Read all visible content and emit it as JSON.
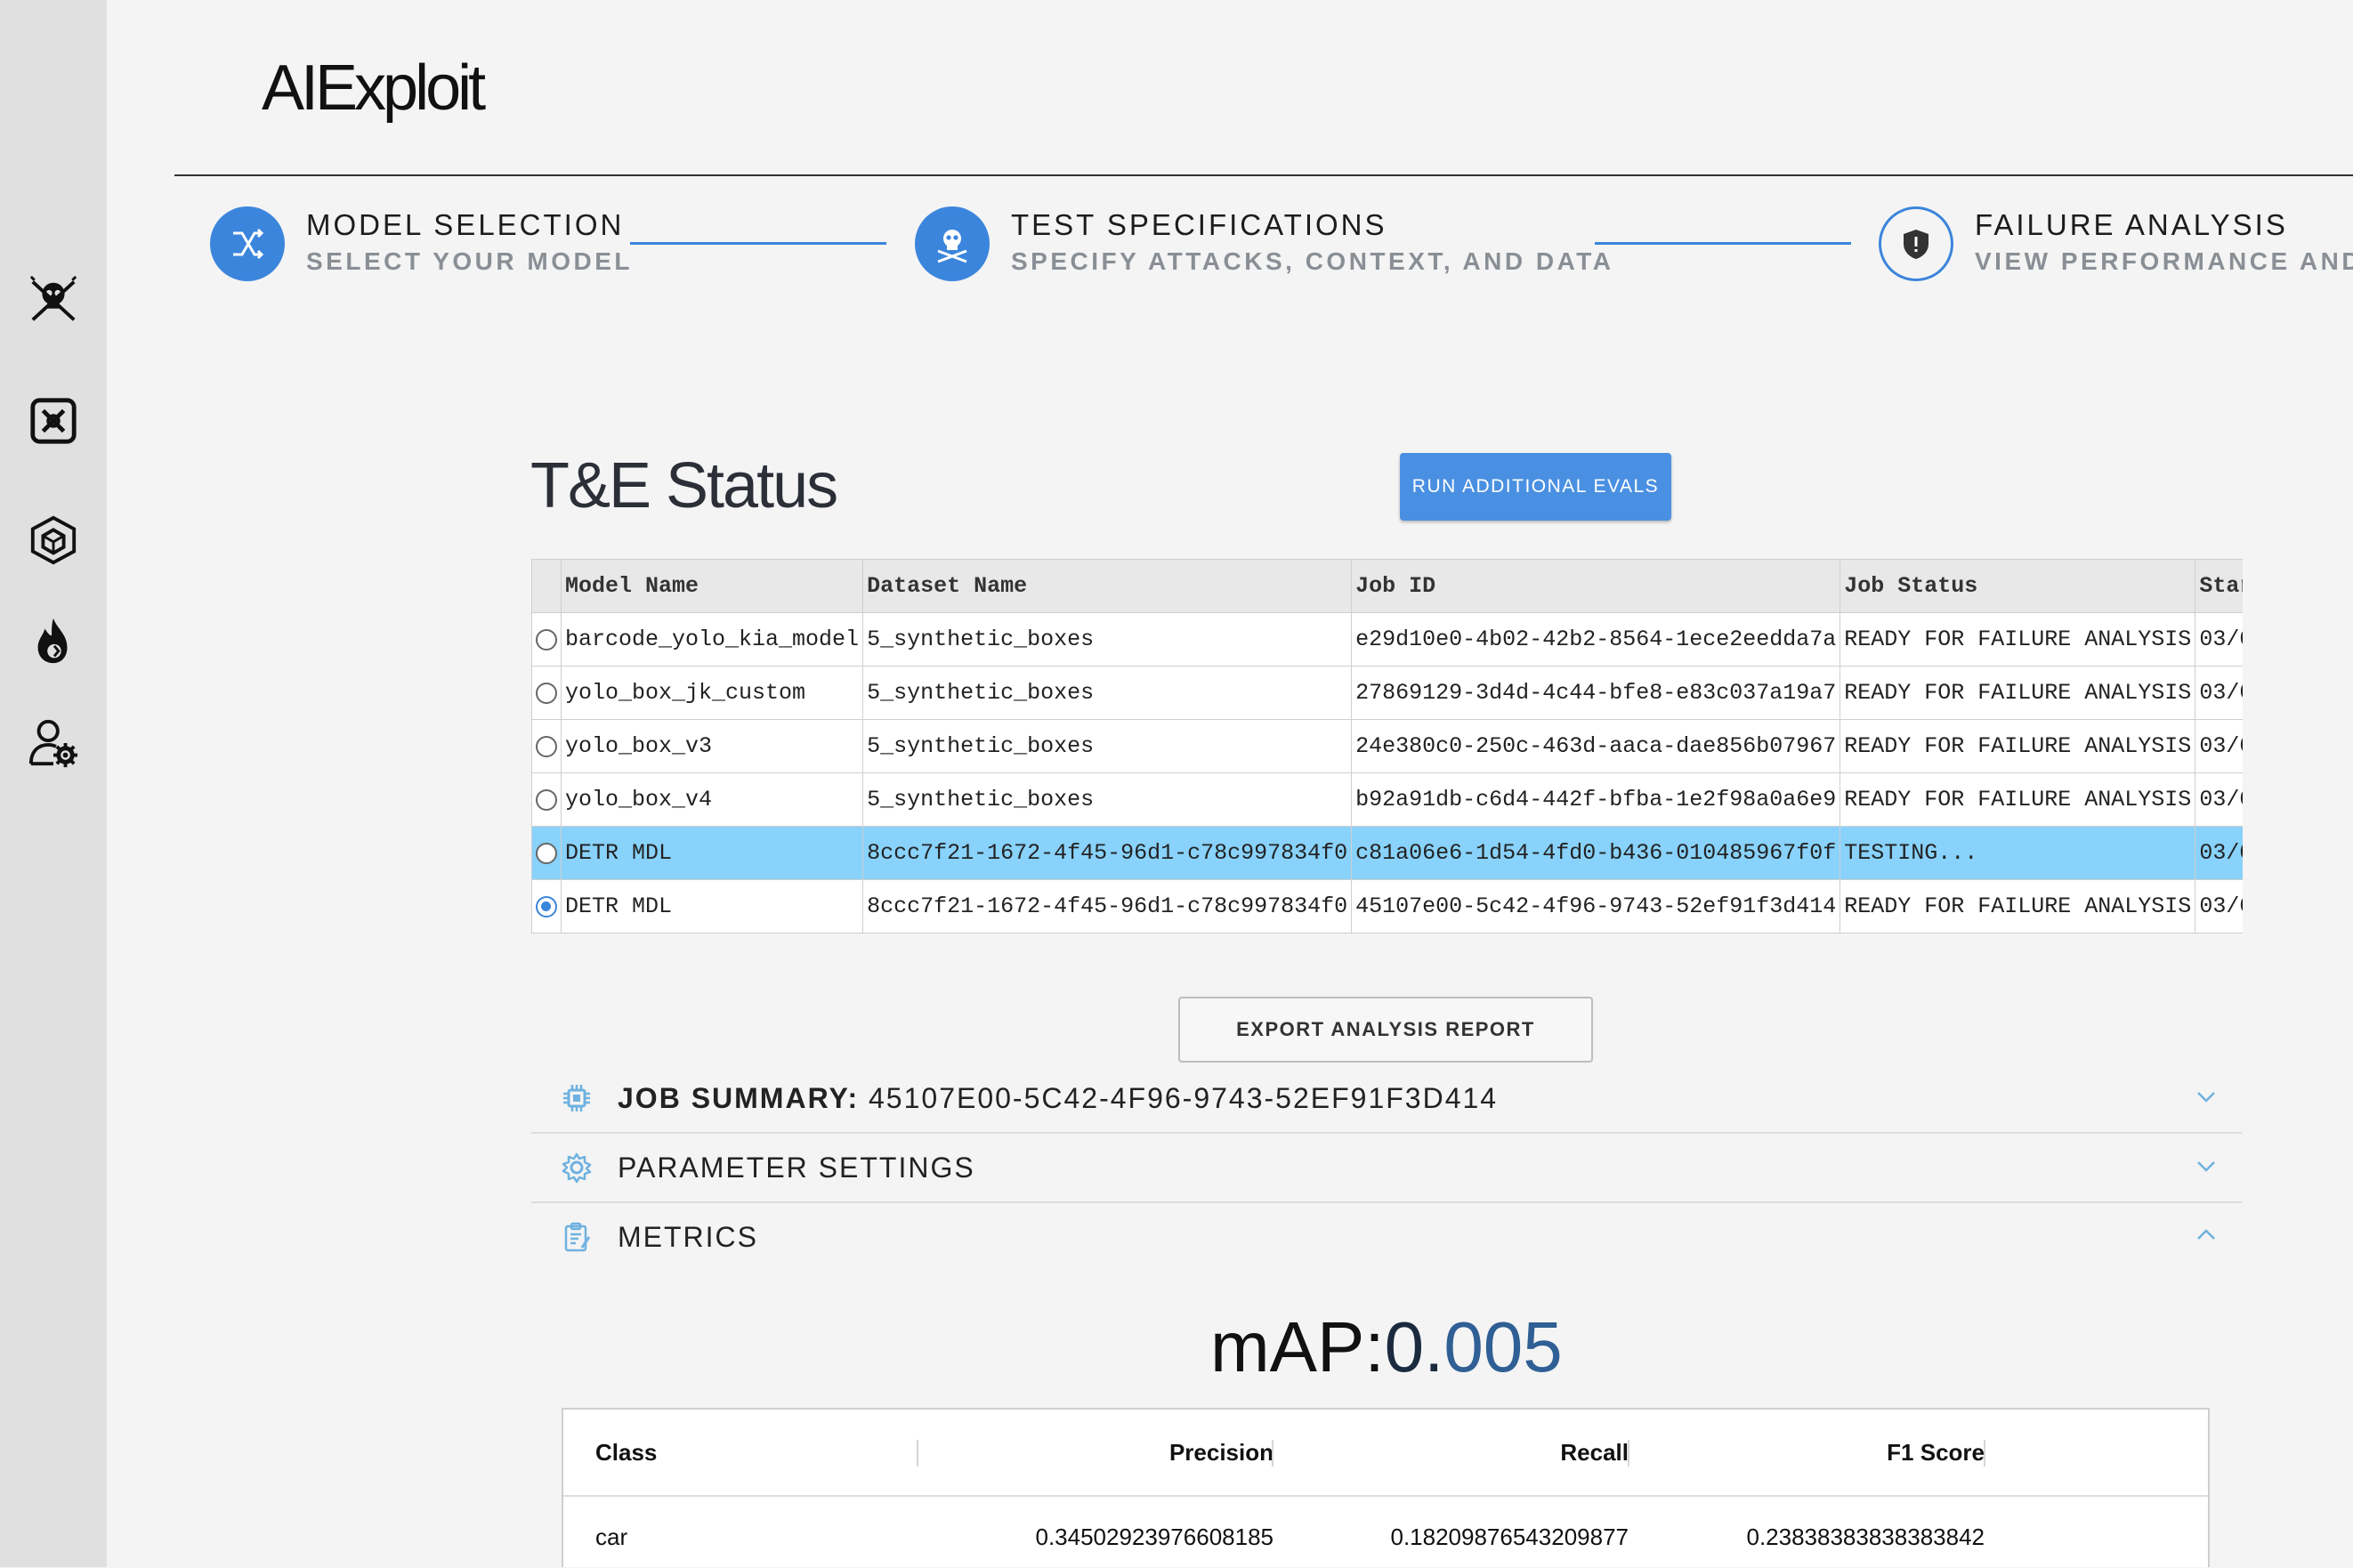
{
  "app": {
    "title": "AIExploit"
  },
  "sidebar": {
    "icons": [
      "skull-crossbones-icon",
      "model-box-icon",
      "cube-icon",
      "fire-icon",
      "user-settings-icon"
    ]
  },
  "stepper": {
    "steps": [
      {
        "title": "MODEL SELECTION",
        "subtitle": "SELECT YOUR MODEL",
        "icon": "shuffle-icon",
        "state": "complete"
      },
      {
        "title": "TEST SPECIFICATIONS",
        "subtitle": "SPECIFY ATTACKS, CONTEXT, AND DATA",
        "icon": "skull-icon",
        "state": "complete"
      },
      {
        "title": "FAILURE ANALYSIS",
        "subtitle": "VIEW PERFORMANCE AND F",
        "icon": "shield-alert-icon",
        "state": "active"
      }
    ],
    "accent_color": "#3b85dc"
  },
  "status": {
    "title": "T&E Status",
    "run_button": "RUN ADDITIONAL EVALS"
  },
  "jobs_table": {
    "columns": [
      "Model Name",
      "Dataset Name",
      "Job ID",
      "Job Status",
      "Star"
    ],
    "rows": [
      {
        "model": "barcode_yolo_kia_model",
        "dataset": "5_synthetic_boxes",
        "job_id": "e29d10e0-4b02-42b2-8564-1ece2eedda7a",
        "status": "READY FOR FAILURE ANALYSIS",
        "start": "03/0",
        "selected": false,
        "highlighted": false
      },
      {
        "model": "yolo_box_jk_custom",
        "dataset": "5_synthetic_boxes",
        "job_id": "27869129-3d4d-4c44-bfe8-e83c037a19a7",
        "status": "READY FOR FAILURE ANALYSIS",
        "start": "03/0",
        "selected": false,
        "highlighted": false
      },
      {
        "model": "yolo_box_v3",
        "dataset": "5_synthetic_boxes",
        "job_id": "24e380c0-250c-463d-aaca-dae856b07967",
        "status": "READY FOR FAILURE ANALYSIS",
        "start": "03/0",
        "selected": false,
        "highlighted": false
      },
      {
        "model": "yolo_box_v4",
        "dataset": "5_synthetic_boxes",
        "job_id": "b92a91db-c6d4-442f-bfba-1e2f98a0a6e9",
        "status": "READY FOR FAILURE ANALYSIS",
        "start": "03/0",
        "selected": false,
        "highlighted": false
      },
      {
        "model": "DETR MDL",
        "dataset": "8ccc7f21-1672-4f45-96d1-c78c997834f0",
        "job_id": "c81a06e6-1d54-4fd0-b436-010485967f0f",
        "status": "TESTING...",
        "start": "03/0",
        "selected": false,
        "highlighted": true
      },
      {
        "model": "DETR MDL",
        "dataset": "8ccc7f21-1672-4f45-96d1-c78c997834f0",
        "job_id": "45107e00-5c42-4f96-9743-52ef91f3d414",
        "status": "READY FOR FAILURE ANALYSIS",
        "start": "03/0",
        "selected": true,
        "highlighted": false
      }
    ],
    "highlight_color": "#88d2fb"
  },
  "export_button": "EXPORT ANALYSIS REPORT",
  "accordion": {
    "job_summary": {
      "label": "JOB SUMMARY:",
      "value": "45107E00-5C42-4F96-9743-52EF91F3D414",
      "expanded": false
    },
    "parameter_settings": {
      "label": "PARAMETER SETTINGS",
      "expanded": false
    },
    "metrics": {
      "label": "METRICS",
      "expanded": true
    }
  },
  "metrics": {
    "map_label": "mAP:",
    "map_int": "0.",
    "map_frac": "005",
    "columns": [
      "Class",
      "Precision",
      "Recall",
      "F1 Score"
    ],
    "rows": [
      {
        "class": "car",
        "precision": "0.34502923976608185",
        "recall": "0.18209876543209877",
        "f1": "0.23838383838383842"
      }
    ]
  }
}
